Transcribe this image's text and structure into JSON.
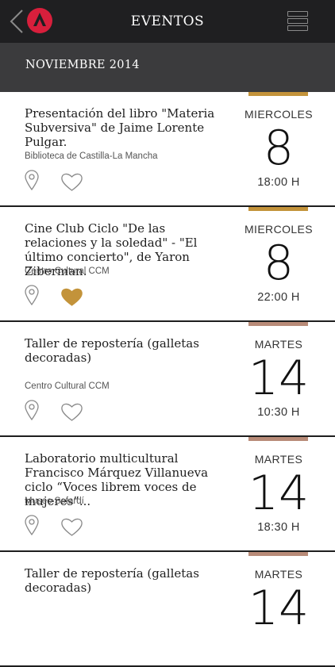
{
  "header": {
    "title": "EVENTOS"
  },
  "section": {
    "title": "NOVIEMBRE 2014"
  },
  "colors": {
    "gold": "#c3933a",
    "rose": "#b88b78",
    "topbar": "#1f1f21",
    "section": "#3b3b3d"
  },
  "events": [
    {
      "title": "Presentación del libro \"Materia Subversiva\" de Jaime Lorente Pulgar.",
      "venue": "Biblioteca de Castilla-La Mancha",
      "day": "MIERCOLES",
      "date": "8",
      "time": "18:00 H",
      "favorite": false,
      "accent": "gold"
    },
    {
      "title": "Cine Club Ciclo \"De las relaciones y la soledad\" - \"El último concierto\", de Yaron Ziberman.",
      "venue": "Centro Cultural CCM",
      "day": "MIERCOLES",
      "date": "8",
      "time": "22:00 H",
      "favorite": true,
      "accent": "gold"
    },
    {
      "title": "Taller de repostería (galletas decoradas)",
      "venue": "Centro Cultural CCM",
      "day": "MARTES",
      "date": "14",
      "time": "10:30 H",
      "favorite": false,
      "accent": "rose"
    },
    {
      "title": "Laboratorio multicultural Francisco Márquez Villanueva ciclo “Voces librem voces de mujeres”...",
      "venue": "Museo Sefardí",
      "day": "MARTES",
      "date": "14",
      "time": "18:30 H",
      "favorite": false,
      "accent": "rose"
    },
    {
      "title": "Taller de repostería (galletas decoradas)",
      "venue": "",
      "day": "MARTES",
      "date": "14",
      "time": "",
      "favorite": false,
      "accent": "rose"
    }
  ]
}
